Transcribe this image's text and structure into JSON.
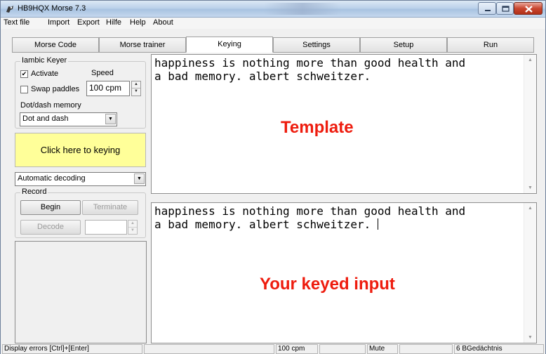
{
  "window": {
    "title": "HB9HQX Morse 7.3",
    "icons": [
      "app-icon",
      "minimize-icon",
      "maximize-icon",
      "close-icon"
    ]
  },
  "menu": [
    "Text file",
    "Import",
    "Export",
    "Hilfe",
    "Help",
    "About"
  ],
  "tabs": [
    {
      "label": "Morse Code",
      "active": false
    },
    {
      "label": "Morse trainer",
      "active": false
    },
    {
      "label": "Keying",
      "active": true
    },
    {
      "label": "Settings",
      "active": false
    },
    {
      "label": "Setup",
      "active": false
    },
    {
      "label": "Run",
      "active": false
    }
  ],
  "iambic": {
    "title": "Iambic Keyer",
    "activate_label": "Activate",
    "activate_checked": true,
    "swap_label": "Swap paddles",
    "swap_checked": false,
    "speed_label": "Speed",
    "speed_value": "100 cpm",
    "memory_label": "Dot/dash memory",
    "memory_value": "Dot and dash"
  },
  "key_button": "Click here to keying",
  "decoding_value": "Automatic decoding",
  "record": {
    "title": "Record",
    "begin": "Begin",
    "terminate": "Terminate",
    "decode": "Decode",
    "decode_value": ""
  },
  "template": {
    "text_line1": "happiness is nothing more than good health and",
    "text_line2": "a bad memory. albert schweitzer.",
    "overlay": "Template"
  },
  "input": {
    "text_line1": "happiness is nothing more than good health and",
    "text_line2": "a bad memory. albert schweitzer. ",
    "overlay": "Your keyed input"
  },
  "status": {
    "errors": "Display errors  [Ctrl]+[Enter]",
    "cell2": "",
    "speed": "100 cpm",
    "cell4": "",
    "mute": "Mute",
    "cell6": "",
    "memory": "6 BGedächtnis"
  },
  "colors": {
    "key_button_bg": "#ffff99",
    "overlay_red": "#ee1c0e"
  }
}
